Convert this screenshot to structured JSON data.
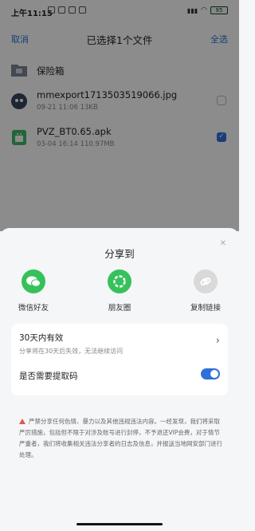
{
  "status_bar": {
    "time": "上午11:15",
    "battery": "95"
  },
  "header": {
    "cancel_label": "取消",
    "title": "已选择1个文件",
    "select_all_label": "全选"
  },
  "files": [
    {
      "name": "保险箱",
      "meta": "",
      "type": "folder",
      "checked": null
    },
    {
      "name": "mmexport1713503519066.jpg",
      "meta": "09-21 11:06  13KB",
      "type": "image",
      "checked": false
    },
    {
      "name": "PVZ_BT0.65.apk",
      "meta": "03-04 16:14  110.97MB",
      "type": "apk",
      "checked": true
    }
  ],
  "share_sheet": {
    "title": "分享到",
    "targets": [
      {
        "label": "微信好友",
        "icon": "wechat-icon",
        "color": "#36c15b"
      },
      {
        "label": "朋友圈",
        "icon": "moments-icon",
        "color": "#36c15b"
      },
      {
        "label": "复制链接",
        "icon": "link-icon",
        "color": "#d9d9d9"
      }
    ],
    "validity": {
      "title": "30天内有效",
      "subtitle": "分享将在30天后失效，无法继续访问"
    },
    "extraction_code": {
      "label": "是否需要提取码",
      "enabled": true
    },
    "notice": "严禁分享任何色情、暴力以及其他违规违法内容。一经发现，我们将采取严厉措施，包括但不限于对涉及账号进行封停，不予退还VIP会费，对于情节严重者，我们将收集相关违法分享者的日志及信息，并报送当地网安部门进行处理。"
  },
  "colors": {
    "accent": "#2f6fda",
    "link_text": "#2a73d6",
    "wechat_green": "#36c15b",
    "warning": "#e2554f"
  }
}
